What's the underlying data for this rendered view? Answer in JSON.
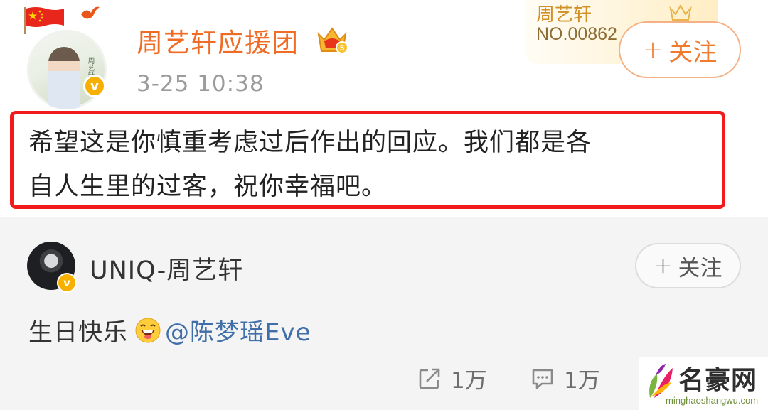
{
  "post": {
    "author": "周艺轩应援团",
    "time": "3-25 10:38",
    "verified_mark": "v",
    "follow_label": "关注",
    "follow_plus": "+",
    "content_line1": "希望这是你慎重考虑过后作出的回应。我们都是各",
    "content_line2": "自人生里的过客，祝你幸福吧。",
    "highlight_color": "#f21b1b",
    "author_color": "#f06b24",
    "icons": [
      "china-flag-icon",
      "bird-icon",
      "crown-level-icon",
      "verified-badge-icon"
    ]
  },
  "fan_card": {
    "name": "周艺轩",
    "number": "NO.00862"
  },
  "repost": {
    "author": "UNIQ-周艺轩",
    "verified_mark": "v",
    "follow_label": "关注",
    "follow_plus": "+",
    "text_prefix": "生日快乐",
    "emoji_icon": "laughing-face-icon",
    "mention": "@陈梦瑶Eve",
    "repost_count": "1万",
    "comment_count": "1万",
    "mention_color": "#3f6ea8"
  },
  "watermark": {
    "title": "名豪网",
    "url": "minghaoshangwu.com"
  }
}
